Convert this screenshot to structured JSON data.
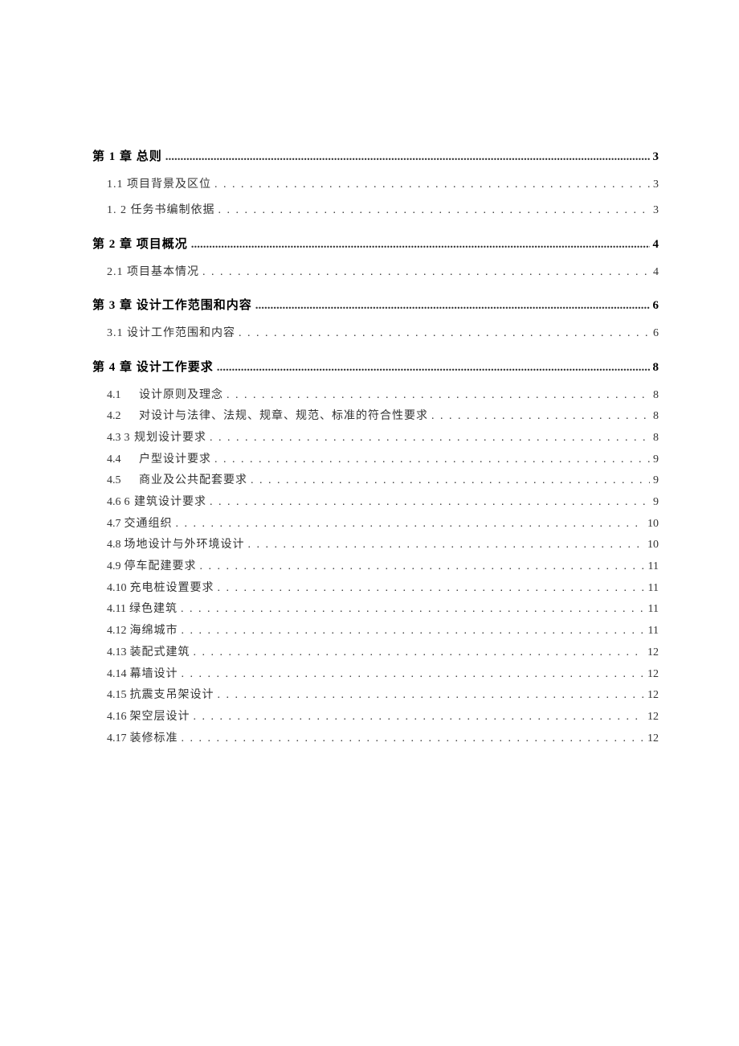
{
  "toc": [
    {
      "level": "chapter",
      "label": "第 1 章 总则",
      "page": "3",
      "leader": "dots-small"
    },
    {
      "level": "section",
      "label": "1.1 项目背景及区位",
      "page": "3",
      "leader": "dots-wide"
    },
    {
      "level": "section",
      "label": "1. 2 任务书编制依据",
      "page": "3",
      "leader": "dots-wide"
    },
    {
      "level": "chapter",
      "label": "第 2 章 项目概况",
      "page": "4",
      "leader": "dots-small"
    },
    {
      "level": "section",
      "label": "2.1 项目基本情况",
      "page": "4",
      "leader": "dots-wide"
    },
    {
      "level": "chapter",
      "label": "第 3 章 设计工作范围和内容",
      "page": "6",
      "leader": "dots-small"
    },
    {
      "level": "section",
      "label": "3.1 设计工作范围和内容",
      "page": "6",
      "leader": "dots-wide"
    },
    {
      "level": "chapter",
      "label": "第 4 章 设计工作要求",
      "page": "8",
      "leader": "dots-small"
    },
    {
      "level": "subsection",
      "num": "4.1",
      "title": "设计原则及理念",
      "page": "8",
      "indent": true
    },
    {
      "level": "subsection",
      "num": "4.2",
      "title": "对设计与法律、法规、规章、规范、标准的符合性要求",
      "page": "8",
      "indent": true
    },
    {
      "level": "subsection",
      "num": "4.3",
      "title": "3 规划设计要求",
      "page": "8"
    },
    {
      "level": "subsection",
      "num": "4.4",
      "title": "户型设计要求",
      "page": "9",
      "indent": true
    },
    {
      "level": "subsection",
      "num": "4.5",
      "title": "商业及公共配套要求",
      "page": "9",
      "indent": true
    },
    {
      "level": "subsection",
      "num": "4.6",
      "title": "6 建筑设计要求",
      "page": "9"
    },
    {
      "level": "subsection",
      "num": "4.7",
      "title": "交通组织",
      "page": "10"
    },
    {
      "level": "subsection",
      "num": "4.8",
      "title": "场地设计与外环境设计",
      "page": "10"
    },
    {
      "level": "subsection",
      "num": "4.9",
      "title": "停车配建要求",
      "page": "11"
    },
    {
      "level": "subsection",
      "num": "4.10",
      "title": "充电桩设置要求",
      "page": "11"
    },
    {
      "level": "subsection",
      "num": "4.11",
      "title": "绿色建筑",
      "page": "11"
    },
    {
      "level": "subsection",
      "num": "4.12",
      "title": "海绵城市",
      "page": "11"
    },
    {
      "level": "subsection",
      "num": "4.13",
      "title": "装配式建筑",
      "page": "12"
    },
    {
      "level": "subsection",
      "num": "4.14",
      "title": "幕墙设计",
      "page": "12"
    },
    {
      "level": "subsection",
      "num": "4.15",
      "title": "抗震支吊架设计",
      "page": "12"
    },
    {
      "level": "subsection",
      "num": "4.16",
      "title": "架空层设计",
      "page": "12"
    },
    {
      "level": "subsection",
      "num": "4.17",
      "title": "装修标准",
      "page": "12"
    }
  ],
  "leaders": {
    "dots-small": "..........................................................................................................................................................................................................................................",
    "dots-wide": ". . . . . . . . . . . . . . . . . . . . . . . . . . . . . . . . . . . . . . . . . . . . . . . . . . . . . . . . . . . . . . . . . . . . . . . . . . . . . . . . . . . . . . . . . . . . . . ."
  }
}
